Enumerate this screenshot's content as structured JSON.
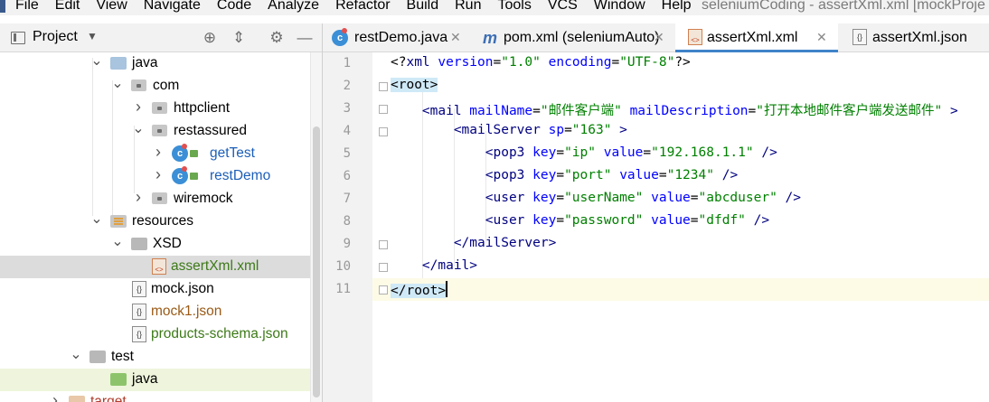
{
  "menu": {
    "items": [
      "File",
      "Edit",
      "View",
      "Navigate",
      "Code",
      "Analyze",
      "Refactor",
      "Build",
      "Run",
      "Tools",
      "VCS",
      "Window",
      "Help"
    ],
    "window_title": "seleniumCoding - assertXml.xml [mockProje"
  },
  "project_panel": {
    "title": "Project"
  },
  "tree": [
    {
      "label": "java",
      "indent": 1,
      "arrow": "down",
      "icon": "folder"
    },
    {
      "label": "com",
      "indent": 2,
      "arrow": "down",
      "icon": "package"
    },
    {
      "label": "httpclient",
      "indent": 3,
      "arrow": "right",
      "icon": "package"
    },
    {
      "label": "restassured",
      "indent": 3,
      "arrow": "down",
      "icon": "package"
    },
    {
      "label": "getTest",
      "indent": 4,
      "arrow": "right",
      "icon": "class"
    },
    {
      "label": "restDemo",
      "indent": 4,
      "arrow": "right",
      "icon": "class"
    },
    {
      "label": "wiremock",
      "indent": 3,
      "arrow": "right",
      "icon": "package"
    },
    {
      "label": "resources",
      "indent": 1,
      "arrow": "down",
      "icon": "resources"
    },
    {
      "label": "XSD",
      "indent": 2,
      "arrow": "down",
      "icon": "folder-gray"
    },
    {
      "label": "assertXml.xml",
      "indent": 3,
      "arrow": "",
      "icon": "xml"
    },
    {
      "label": "mock.json",
      "indent": 2,
      "arrow": "",
      "icon": "json"
    },
    {
      "label": "mock1.json",
      "indent": 2,
      "arrow": "",
      "icon": "json"
    },
    {
      "label": "products-schema.json",
      "indent": 2,
      "arrow": "",
      "icon": "json"
    },
    {
      "label": "test",
      "indent": 0,
      "arrow": "down",
      "icon": "folder-gray"
    },
    {
      "label": "java",
      "indent": 1,
      "arrow": "",
      "icon": "folder-green"
    },
    {
      "label": "target",
      "indent": -1,
      "arrow": "right",
      "icon": "folder-pale"
    }
  ],
  "tabs": [
    {
      "label": "restDemo.java",
      "icon": "class-icon"
    },
    {
      "label": "pom.xml (seleniumAuto)",
      "icon": "maven-icon"
    },
    {
      "label": "assertXml.xml",
      "icon": "xml-icon"
    },
    {
      "label": "assertXml.json",
      "icon": "json-icon"
    }
  ],
  "editor": {
    "line_numbers": [
      "1",
      "2",
      "3",
      "4",
      "5",
      "6",
      "7",
      "8",
      "9",
      "10",
      "11"
    ],
    "lines": [
      {
        "indent": 0,
        "tokens": [
          [
            "pi",
            "<?"
          ],
          [
            "k",
            "xml "
          ],
          [
            "a",
            "version"
          ],
          [
            "pi",
            "="
          ],
          [
            "v",
            "\"1.0\""
          ],
          [
            "pi",
            " "
          ],
          [
            "a",
            "encoding"
          ],
          [
            "pi",
            "="
          ],
          [
            "v",
            "\"UTF-8\""
          ],
          [
            "pi",
            "?>"
          ]
        ]
      },
      {
        "indent": 0,
        "tokens": [
          [
            "bm",
            "<root>"
          ]
        ]
      },
      {
        "indent": 1,
        "tokens": [
          [
            "k",
            "<mail "
          ],
          [
            "a",
            "mailName"
          ],
          [
            "pi",
            "="
          ],
          [
            "v",
            "\"邮件客户端\""
          ],
          [
            "pi",
            " "
          ],
          [
            "a",
            "mailDescription"
          ],
          [
            "pi",
            "="
          ],
          [
            "v",
            "\"打开本地邮件客户端发送邮件\""
          ],
          [
            "k",
            " >"
          ]
        ]
      },
      {
        "indent": 2,
        "tokens": [
          [
            "k",
            "<mailServer "
          ],
          [
            "a",
            "sp"
          ],
          [
            "pi",
            "="
          ],
          [
            "v",
            "\"163\""
          ],
          [
            "k",
            " >"
          ]
        ]
      },
      {
        "indent": 3,
        "tokens": [
          [
            "k",
            "<pop3 "
          ],
          [
            "a",
            "key"
          ],
          [
            "pi",
            "="
          ],
          [
            "v",
            "\"ip\""
          ],
          [
            "pi",
            " "
          ],
          [
            "a",
            "value"
          ],
          [
            "pi",
            "="
          ],
          [
            "v",
            "\"192.168.1.1\""
          ],
          [
            "k",
            " />"
          ]
        ]
      },
      {
        "indent": 3,
        "tokens": [
          [
            "k",
            "<pop3 "
          ],
          [
            "a",
            "key"
          ],
          [
            "pi",
            "="
          ],
          [
            "v",
            "\"port\""
          ],
          [
            "pi",
            " "
          ],
          [
            "a",
            "value"
          ],
          [
            "pi",
            "="
          ],
          [
            "v",
            "\"1234\""
          ],
          [
            "k",
            " />"
          ]
        ]
      },
      {
        "indent": 3,
        "tokens": [
          [
            "k",
            "<user "
          ],
          [
            "a",
            "key"
          ],
          [
            "pi",
            "="
          ],
          [
            "v",
            "\"userName\""
          ],
          [
            "pi",
            " "
          ],
          [
            "a",
            "value"
          ],
          [
            "pi",
            "="
          ],
          [
            "v",
            "\"abcduser\""
          ],
          [
            "k",
            " />"
          ]
        ]
      },
      {
        "indent": 3,
        "tokens": [
          [
            "k",
            "<user "
          ],
          [
            "a",
            "key"
          ],
          [
            "pi",
            "="
          ],
          [
            "v",
            "\"password\""
          ],
          [
            "pi",
            " "
          ],
          [
            "a",
            "value"
          ],
          [
            "pi",
            "="
          ],
          [
            "v",
            "\"dfdf\""
          ],
          [
            "k",
            " />"
          ]
        ]
      },
      {
        "indent": 2,
        "tokens": [
          [
            "k",
            "</mailServer>"
          ]
        ]
      },
      {
        "indent": 1,
        "tokens": [
          [
            "k",
            "</mail>"
          ]
        ]
      },
      {
        "indent": 0,
        "tokens": [
          [
            "bm",
            "</root>"
          ]
        ]
      }
    ]
  }
}
